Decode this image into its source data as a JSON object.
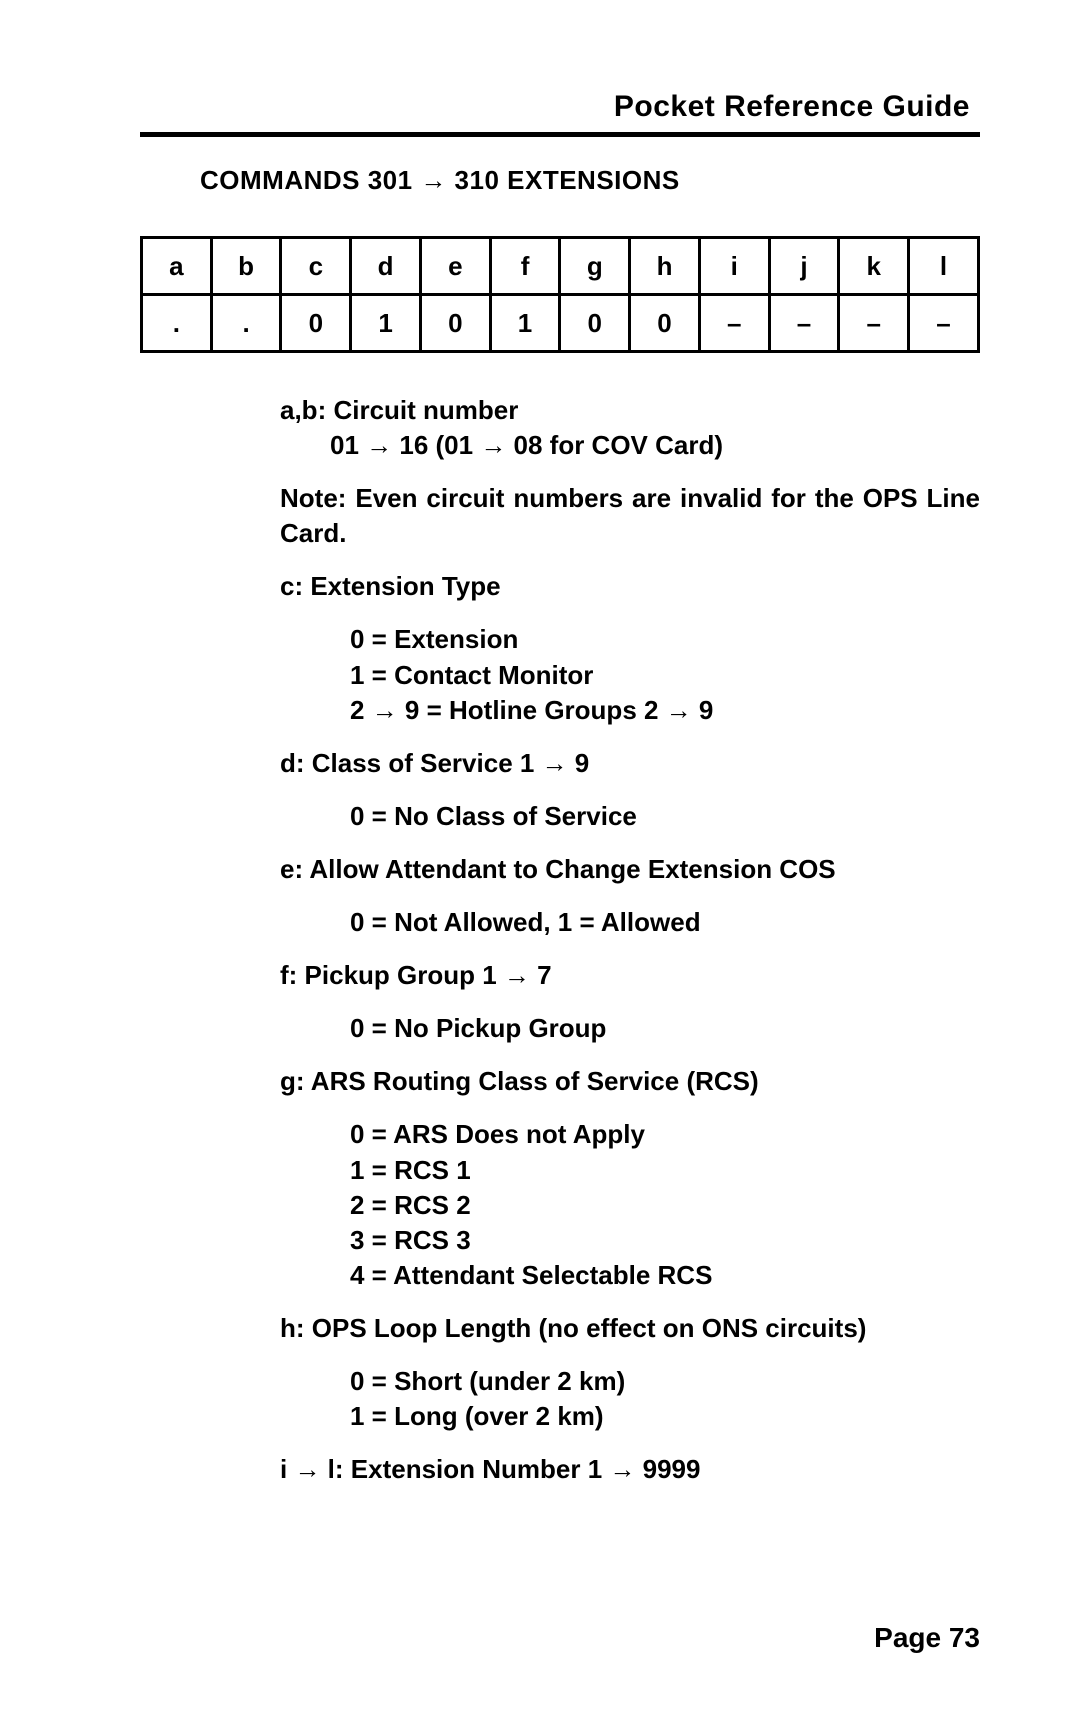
{
  "header": {
    "title": "Pocket Reference Guide"
  },
  "section_title": "COMMANDS 301 → 310 EXTENSIONS",
  "table": {
    "row1": [
      "a",
      "b",
      "c",
      "d",
      "e",
      "f",
      "g",
      "h",
      "i",
      "j",
      "k",
      "l"
    ],
    "row2": [
      ".",
      ".",
      "0",
      "1",
      "0",
      "1",
      "0",
      "0",
      "–",
      "–",
      "–",
      "–"
    ]
  },
  "definitions": {
    "ab_label": "a,b: Circuit number",
    "ab_detail": "01 → 16 (01 → 08 for COV Card)",
    "note_label": "Note:",
    "note_text": "Even circuit numbers are invalid for the OPS Line Card.",
    "c_label": "c: Extension Type",
    "c_items": {
      "i0": "0 = Extension",
      "i1": "1 = Contact Monitor",
      "i2": "2 → 9 = Hotline Groups 2 → 9"
    },
    "d_label": "d: Class of Service 1 → 9",
    "d_item": "0 = No Class of Service",
    "e_label": "e: Allow Attendant to Change Extension COS",
    "e_item": "0 = Not Allowed, 1 = Allowed",
    "f_label": "f: Pickup Group 1 → 7",
    "f_item": "0 = No Pickup Group",
    "g_label": "g: ARS Routing Class of Service (RCS)",
    "g_items": {
      "i0": "0 = ARS Does not Apply",
      "i1": "1 = RCS 1",
      "i2": "2 = RCS 2",
      "i3": "3 = RCS 3",
      "i4": "4 = Attendant Selectable RCS"
    },
    "h_label": "h: OPS Loop Length (no effect on ONS circuits)",
    "h_items": {
      "i0": "0 = Short (under 2 km)",
      "i1": "1 = Long (over 2 km)"
    },
    "il_label": "i → l: Extension Number 1 → 9999"
  },
  "page_number": "Page 73"
}
